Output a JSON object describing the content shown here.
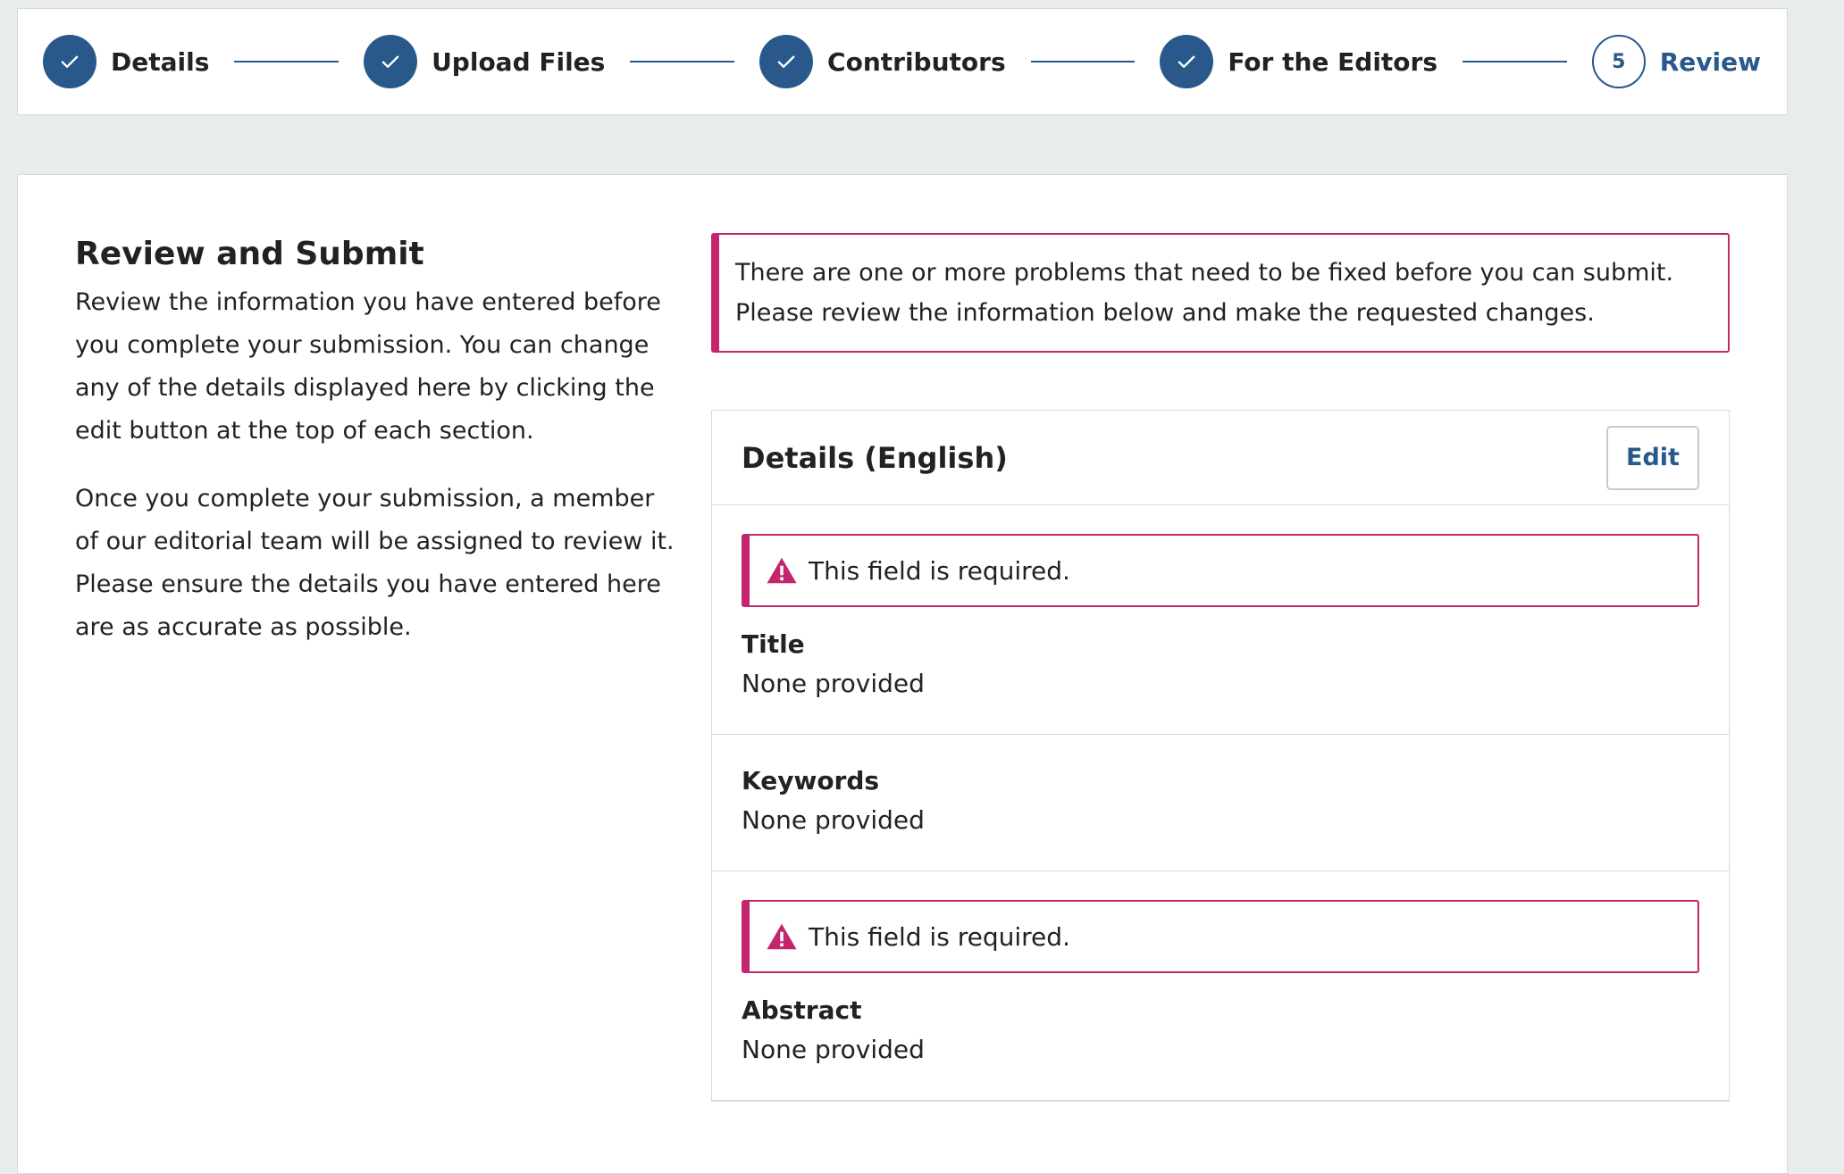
{
  "stepper": {
    "steps": [
      {
        "label": "Details",
        "state": "complete"
      },
      {
        "label": "Upload Files",
        "state": "complete"
      },
      {
        "label": "Contributors",
        "state": "complete"
      },
      {
        "label": "For the Editors",
        "state": "complete"
      },
      {
        "label": "Review",
        "number": "5",
        "state": "current"
      }
    ]
  },
  "intro": {
    "title": "Review and Submit",
    "paragraph1": "Review the information you have entered before you complete your submission. You can change any of the details displayed here by clicking the edit button at the top of each section.",
    "paragraph2": "Once you complete your submission, a member of our editorial team will be assigned to review it. Please ensure the details you have entered here are as accurate as possible."
  },
  "notice": {
    "line1": "There are one or more problems that need to be fixed before you can submit.",
    "line2": "Please review the information below and make the requested changes."
  },
  "details_panel": {
    "title": "Details (English)",
    "edit_label": "Edit",
    "fields": [
      {
        "label": "Title",
        "value": "None provided",
        "error": "This field is required."
      },
      {
        "label": "Keywords",
        "value": "None provided"
      },
      {
        "label": "Abstract",
        "value": "None provided",
        "error": "This field is required."
      }
    ]
  },
  "colors": {
    "primary": "#28598a",
    "error": "#c4266e",
    "background": "#e9eced"
  }
}
